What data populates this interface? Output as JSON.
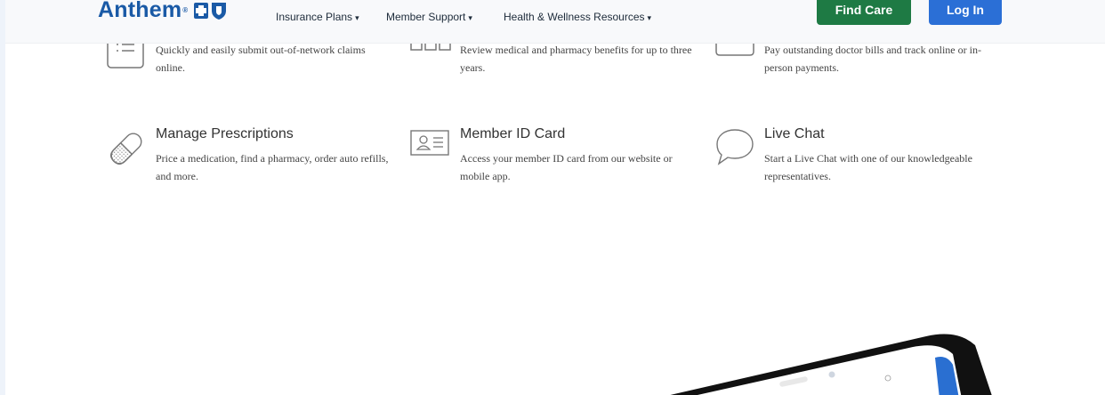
{
  "header": {
    "logo_text": "Anthem",
    "nav": [
      {
        "label": "Insurance Plans"
      },
      {
        "label": "Member Support"
      },
      {
        "label": "Health & Wellness Resources"
      }
    ],
    "find_care_label": "Find Care",
    "login_label": "Log In"
  },
  "features_top": [
    {
      "desc": "Quickly and easily submit out-of-network claims online."
    },
    {
      "desc": "Review medical and pharmacy benefits for up to three years."
    },
    {
      "desc": "Pay outstanding doctor bills and track online or in-person payments."
    }
  ],
  "features_bottom": [
    {
      "title": "Manage Prescriptions",
      "desc": "Price a medication, find a pharmacy, order auto refills, and more.",
      "icon": "pill-icon"
    },
    {
      "title": "Member ID Card",
      "desc": "Access your member ID card from our website or mobile app.",
      "icon": "id-card-icon"
    },
    {
      "title": "Live Chat",
      "desc": "Start a Live Chat with one of our knowledgeable representatives.",
      "icon": "chat-bubble-icon"
    }
  ],
  "colors": {
    "brand": "#1a5aa6",
    "find_care": "#1e7a44",
    "login": "#2b6fd6"
  }
}
